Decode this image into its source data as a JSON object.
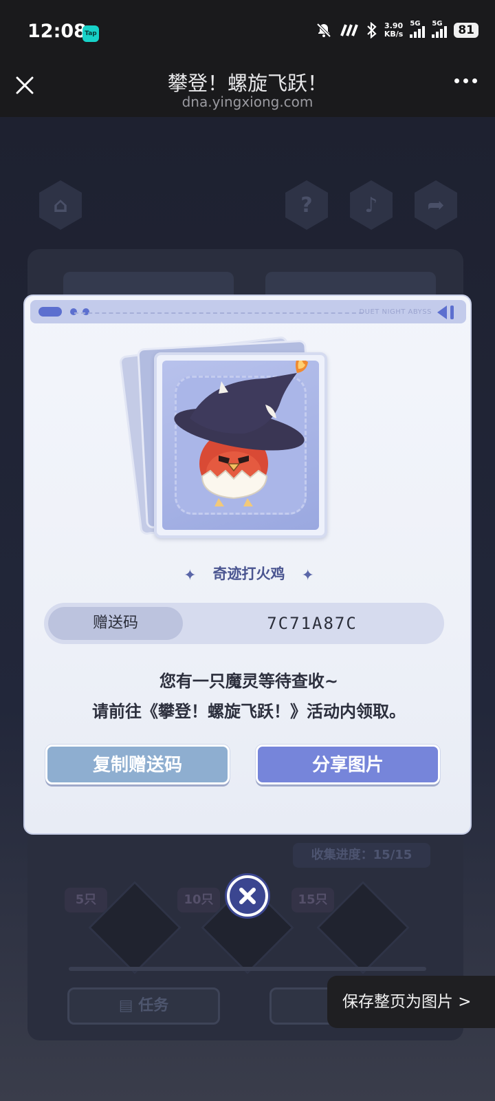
{
  "status_bar": {
    "time": "12:08",
    "tap_badge": "Tap",
    "speed_value": "3.90",
    "speed_unit": "KB/s",
    "sim1": "5G",
    "sim2": "5G",
    "battery": "81"
  },
  "title_bar": {
    "title": "攀登！螺旋飞跃！",
    "url": "dna.yingxiong.com"
  },
  "background": {
    "progress_text": "收集进度：15/15",
    "milestones": [
      "5只",
      "10只",
      "15只"
    ],
    "task_button": "任务"
  },
  "modal": {
    "header_text": "DUET NIGHT ABYSS",
    "item_name": "奇迹打火鸡",
    "code_label": "赠送码",
    "code_value": "7C71A87C",
    "message_line1": "您有一只魔灵等待查收~",
    "message_line2": "请前往《攀登！螺旋飞跃！》活动内领取。",
    "copy_button": "复制赠送码",
    "share_button": "分享图片"
  },
  "toast": {
    "save_text": "保存整页为图片 >"
  },
  "colors": {
    "accent": "#7685da",
    "secondary_button": "#8eaed0",
    "close_circle": "#3b4690"
  }
}
